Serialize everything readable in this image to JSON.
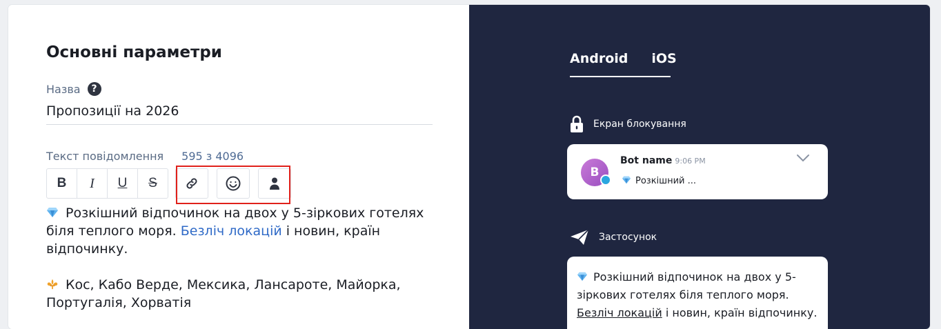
{
  "editor": {
    "title": "Основні параметри",
    "name_label": "Назва",
    "help_glyph": "?",
    "name_value": "Пропозиції на 2026",
    "message_label": "Текст повідомлення",
    "message_counter": "595 з 4096",
    "toolbar": {
      "bold": "B",
      "italic": "I",
      "underline": "U",
      "strike": "S",
      "icons": [
        "link-icon",
        "emoji-icon",
        "user-icon"
      ]
    },
    "body": {
      "p1_text": "Розкішний відпочинок на двох у 5-зіркових готелях біля теплого моря. ",
      "p1_link": "Безліч локацій",
      "p1_tail": " і новин, країн відпочинку.",
      "p2_text": "Кос, Кабо Верде, Мексика, Лансароте, Майорка, Португалія, Хорватія"
    }
  },
  "preview": {
    "tabs": [
      "Android",
      "iOS"
    ],
    "lock_section_title": "Екран блокування",
    "notification": {
      "avatar_letter": "B",
      "bot_name": "Bot name",
      "time": "9:06 PM",
      "preview": "Розкішний ..."
    },
    "app_section_title": "Застосунок",
    "app_message": {
      "text": "Розкішний відпочинок на двох у 5-зіркових готелях біля теплого моря. ",
      "link": "Безліч локацій",
      "tail": " і новин, країн відпочинку."
    }
  },
  "colors": {
    "accent_link": "#2f6ac7",
    "preview_bg": "#1f2640",
    "highlight": "#e0201a"
  }
}
